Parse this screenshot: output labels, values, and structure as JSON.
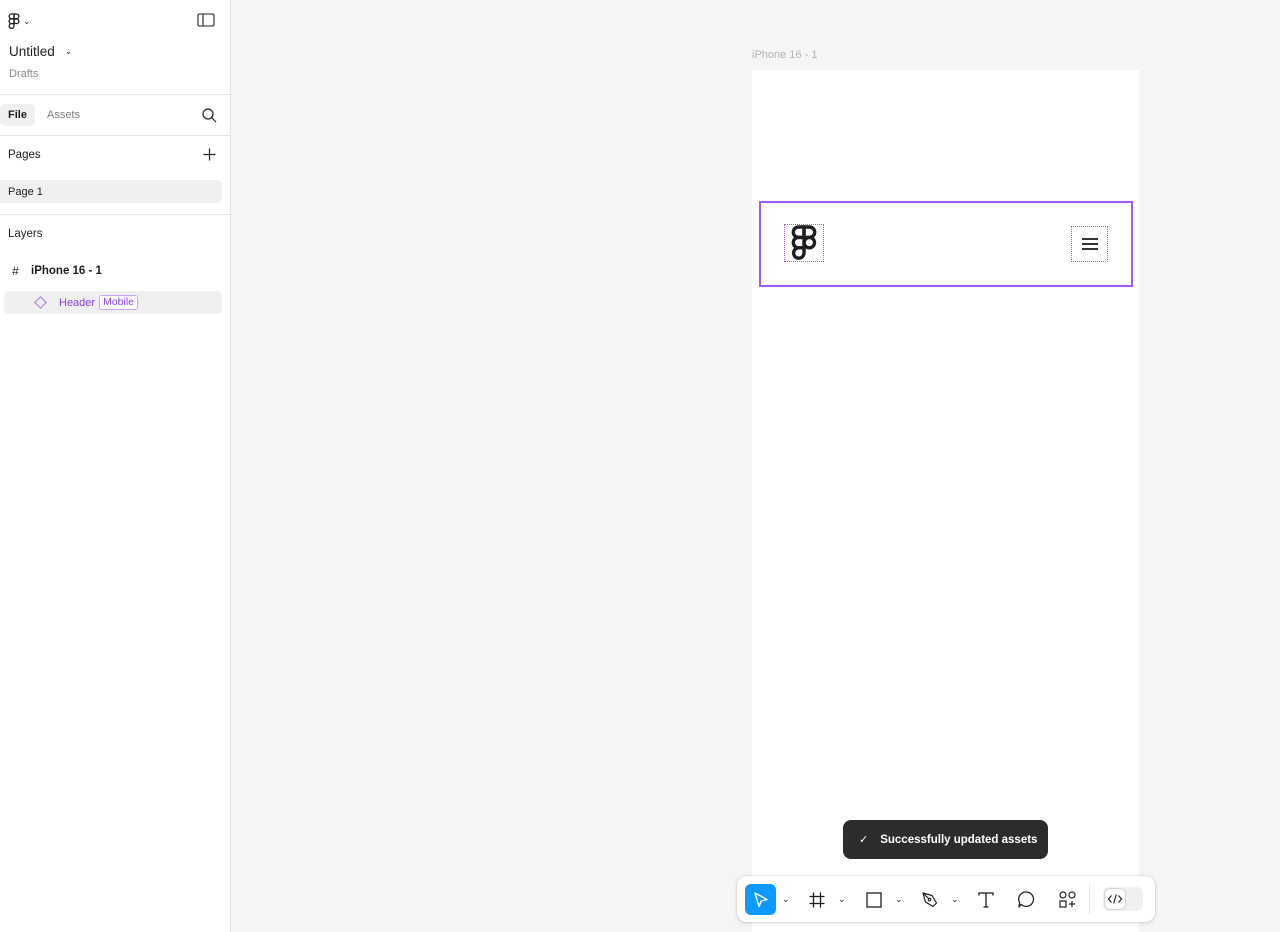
{
  "sidebar": {
    "file_title": "Untitled",
    "file_location": "Drafts",
    "tabs": {
      "file": "File",
      "assets": "Assets"
    },
    "pages_label": "Pages",
    "pages": [
      "Page 1"
    ],
    "layers_label": "Layers",
    "layers": {
      "frame": "iPhone 16 - 1",
      "component": "Header",
      "component_variant": "Mobile"
    }
  },
  "canvas": {
    "frame_label": "iPhone 16 - 1",
    "frame_bg": "#ffffff",
    "selection_color": "#a259ff"
  },
  "toast": {
    "text": "Successfully updated assets",
    "icon": "check-icon"
  },
  "toolbar": {
    "tools": [
      "move-tool",
      "frame-tool",
      "shape-tool",
      "pen-tool",
      "text-tool",
      "comment-tool",
      "actions-tool"
    ],
    "active_tool": "move-tool",
    "accent": "#0d99ff",
    "dev_mode_toggle": "dev-mode-toggle"
  }
}
